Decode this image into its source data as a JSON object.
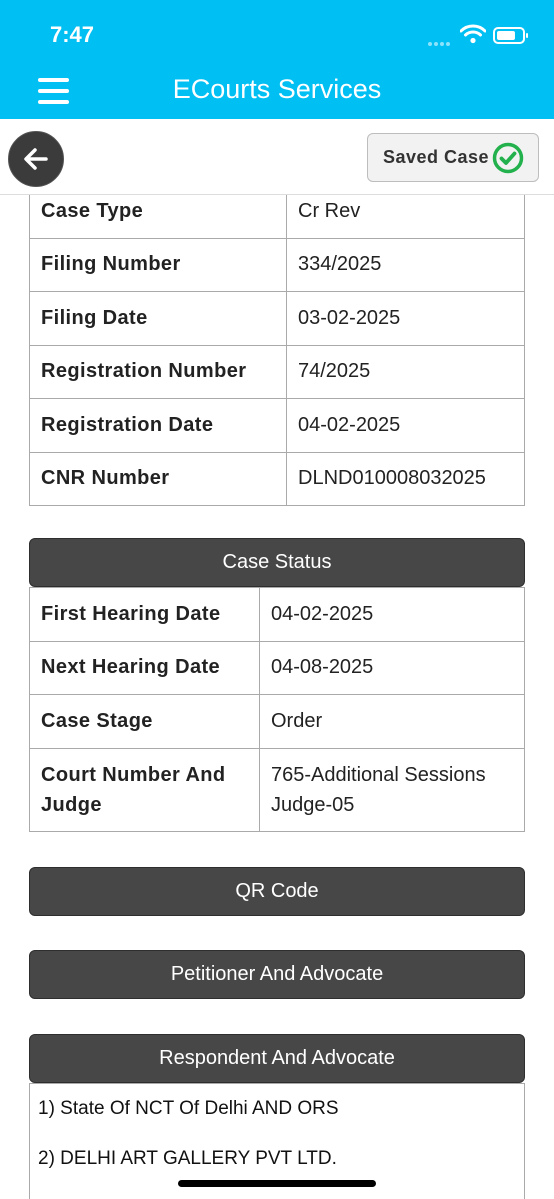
{
  "status_bar": {
    "time": "7:47"
  },
  "header": {
    "title": "ECourts Services",
    "menu_icon": "hamburger-menu-icon"
  },
  "toolbar": {
    "back_icon": "arrow-left-icon",
    "saved_label": "Saved Case",
    "saved_icon": "check-circle-icon",
    "saved_icon_color": "#22b14c"
  },
  "case_details": [
    {
      "label": "Case Type",
      "value": "Cr Rev"
    },
    {
      "label": "Filing Number",
      "value": "334/2025"
    },
    {
      "label": "Filing Date",
      "value": "03-02-2025"
    },
    {
      "label": "Registration Number",
      "value": "74/2025"
    },
    {
      "label": "Registration Date",
      "value": "04-02-2025"
    },
    {
      "label": "CNR Number",
      "value": "DLND010008032025"
    }
  ],
  "case_status": {
    "title": "Case Status",
    "rows": [
      {
        "label": "First Hearing Date",
        "value": "04-02-2025"
      },
      {
        "label": "Next Hearing Date",
        "value": "04-08-2025"
      },
      {
        "label": "Case Stage",
        "value": "Order"
      },
      {
        "label": "Court Number And Judge",
        "value": "765-Additional Sessions Judge-05"
      }
    ]
  },
  "sections": {
    "qr_code": "QR Code",
    "petitioner": "Petitioner And Advocate",
    "respondent": "Respondent And Advocate"
  },
  "respondents": [
    "1) State Of NCT Of Delhi AND ORS",
    "2) DELHI ART GALLERY PVT LTD."
  ],
  "colors": {
    "header_bg": "#00bff3",
    "section_bg": "#474747",
    "border": "#aaaaaa"
  }
}
